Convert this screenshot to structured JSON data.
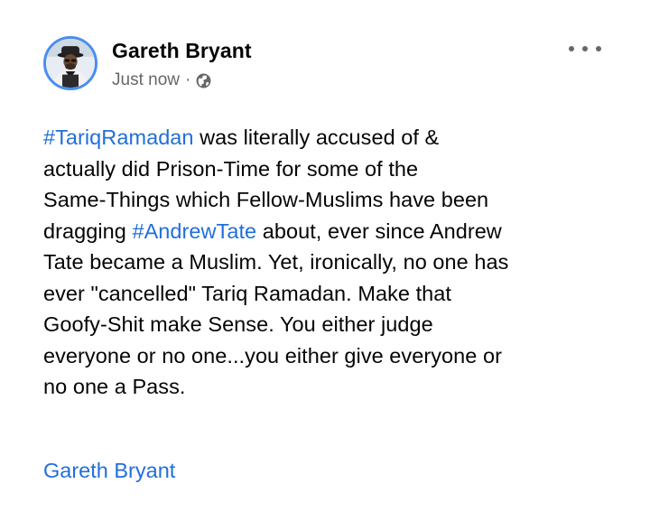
{
  "post": {
    "author": "Gareth Bryant",
    "timestamp": "Just now",
    "separator": "·",
    "privacy_icon": "globe-icon",
    "more_icon": "more-horizontal-icon",
    "body": {
      "l1_tag": "#TariqRamadan",
      "l1_rest": " was literally accused of &",
      "l2": "actually did Prison-Time for some of the",
      "l3": "Same-Things which Fellow-Muslims have been",
      "l4_pre": "dragging ",
      "l4_tag": "#AndrewTate",
      "l4_rest": " about, ever since Andrew",
      "l5": "Tate became a Muslim. Yet, ironically, no one has",
      "l6": "ever \"cancelled\" Tariq Ramadan. Make that",
      "l7": "Goofy-Shit make Sense. You either judge",
      "l8": "everyone or no one...you either give everyone or",
      "l9": "no one a Pass."
    },
    "signature": "Gareth Bryant"
  },
  "colors": {
    "link": "#216fdb",
    "text": "#050505",
    "secondary": "#65676b",
    "avatar_ring": "#4a8df0"
  }
}
